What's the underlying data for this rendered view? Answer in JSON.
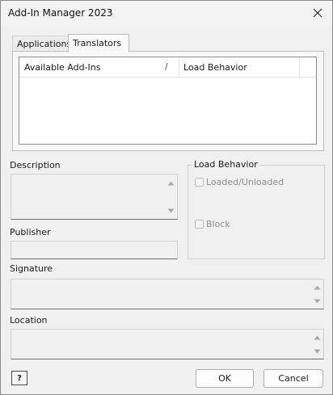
{
  "window": {
    "title": "Add-In Manager 2023"
  },
  "tabs": [
    {
      "label": "Applications",
      "active": false
    },
    {
      "label": "Translators",
      "active": true
    }
  ],
  "list": {
    "columns": [
      "Available Add-Ins",
      "Load Behavior"
    ],
    "sort_glyph": "/",
    "rows": []
  },
  "fields": {
    "description_label": "Description",
    "publisher_label": "Publisher",
    "signature_label": "Signature",
    "location_label": "Location"
  },
  "load_behavior": {
    "title": "Load Behavior",
    "loaded_label": "Loaded/Unloaded",
    "block_label": "Block"
  },
  "buttons": {
    "help": "?",
    "ok": "OK",
    "cancel": "Cancel"
  },
  "icons": {
    "close": "close-icon",
    "scroll_up": "scroll-up-arrow-icon",
    "scroll_down": "scroll-down-arrow-icon",
    "help": "help-icon"
  }
}
